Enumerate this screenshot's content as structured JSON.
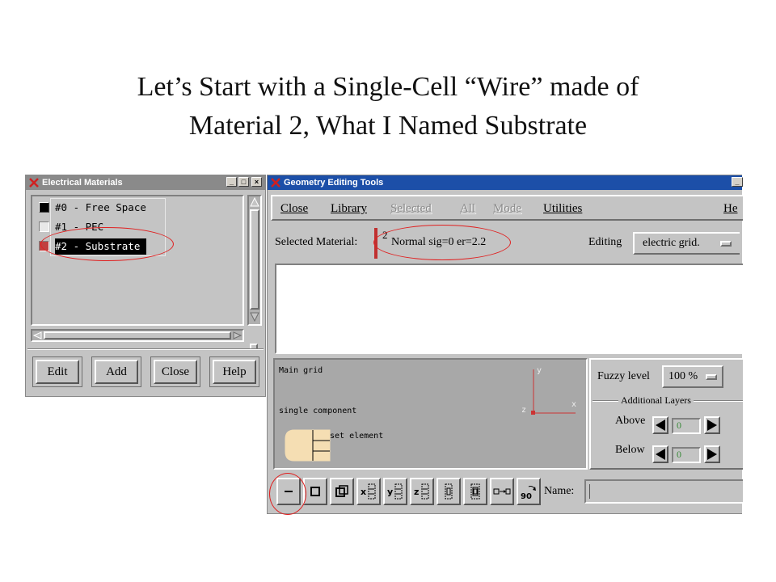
{
  "slide": {
    "title_line1": "Let’s Start with a Single-Cell “Wire” made of",
    "title_line2": "Material 2, What I Named Substrate"
  },
  "materials_window": {
    "title": "Electrical Materials",
    "items": [
      {
        "label": "#0 - Free Space",
        "color": "#000000",
        "selected": false
      },
      {
        "label": "#1 - PEC",
        "color": "#e8e8e8",
        "selected": false
      },
      {
        "label": "#2 - Substrate",
        "color": "#c04040",
        "selected": true
      }
    ],
    "buttons": [
      "Edit",
      "Add",
      "Close",
      "Help"
    ]
  },
  "geometry_window": {
    "title": "Geometry Editing Tools",
    "menu": [
      {
        "label": "Close",
        "enabled": true
      },
      {
        "label": "Library",
        "enabled": true
      },
      {
        "label": "Selected",
        "enabled": false
      },
      {
        "label": "All",
        "enabled": false
      },
      {
        "label": "Mode",
        "enabled": false
      },
      {
        "label": "Utilities",
        "enabled": true
      },
      {
        "label": "He",
        "enabled": true
      }
    ],
    "selected_material_label": "Selected Material:",
    "selected_material_number": "2",
    "selected_material_desc": "Normal sig=0 er=2.2",
    "editing_label": "Editing",
    "editing_value": "electric grid.",
    "grid_panel": {
      "main_grid": "Main grid",
      "single_component": "single component",
      "set_element": "set element",
      "axis_y": "y",
      "axis_x": "x",
      "axis_z": "z"
    },
    "fuzzy_label": "Fuzzy level",
    "fuzzy_value": "100 %",
    "additional_layers_label": "Additional Layers",
    "above_label": "Above",
    "above_value": "0",
    "below_label": "Below",
    "below_value": "0",
    "name_label": "Name:",
    "name_value": "",
    "tools": [
      "line-tool",
      "square-tool",
      "cube-tool",
      "x-extrude-tool",
      "y-extrude-tool",
      "z-extrude-tool",
      "slice-tool",
      "stack-tool",
      "move-tool",
      "rotate-90-tool"
    ],
    "tool_labels": {
      "x": "x",
      "y": "y",
      "z": "z",
      "rot": "90"
    }
  },
  "colors": {
    "titlebar_active": "#1c4fa8",
    "titlebar_inactive": "#8a8a8a",
    "annotation": "#e02020",
    "grid_bg": "#a8a8a8",
    "component_fill": "#f5deb3"
  }
}
